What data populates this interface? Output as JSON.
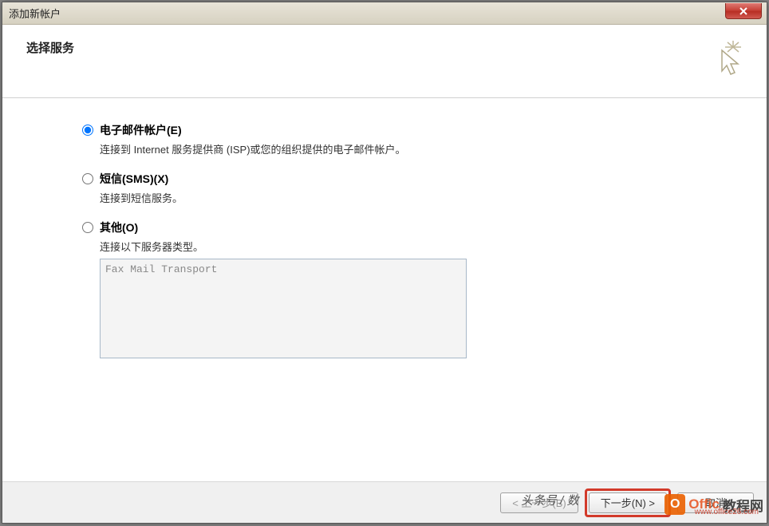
{
  "window": {
    "title": "添加新帐户"
  },
  "header": {
    "title": "选择服务"
  },
  "options": {
    "email": {
      "label": "电子邮件帐户(E)",
      "desc": "连接到 Internet 服务提供商 (ISP)或您的组织提供的电子邮件帐户。",
      "checked": true
    },
    "sms": {
      "label": "短信(SMS)(X)",
      "desc": "连接到短信服务。",
      "checked": false
    },
    "other": {
      "label": "其他(O)",
      "desc": "连接以下服务器类型。",
      "checked": false
    }
  },
  "listbox": {
    "items": [
      "Fax Mail Transport"
    ]
  },
  "buttons": {
    "back": "< 上一步(B)",
    "next": "下一步(N) >",
    "cancel": "取消"
  },
  "overlay": {
    "headline": "头条号 / 数",
    "brand_main": "Offic",
    "brand_sub": "教程网",
    "url": "www.office26.com",
    "logo_letter": "O"
  }
}
